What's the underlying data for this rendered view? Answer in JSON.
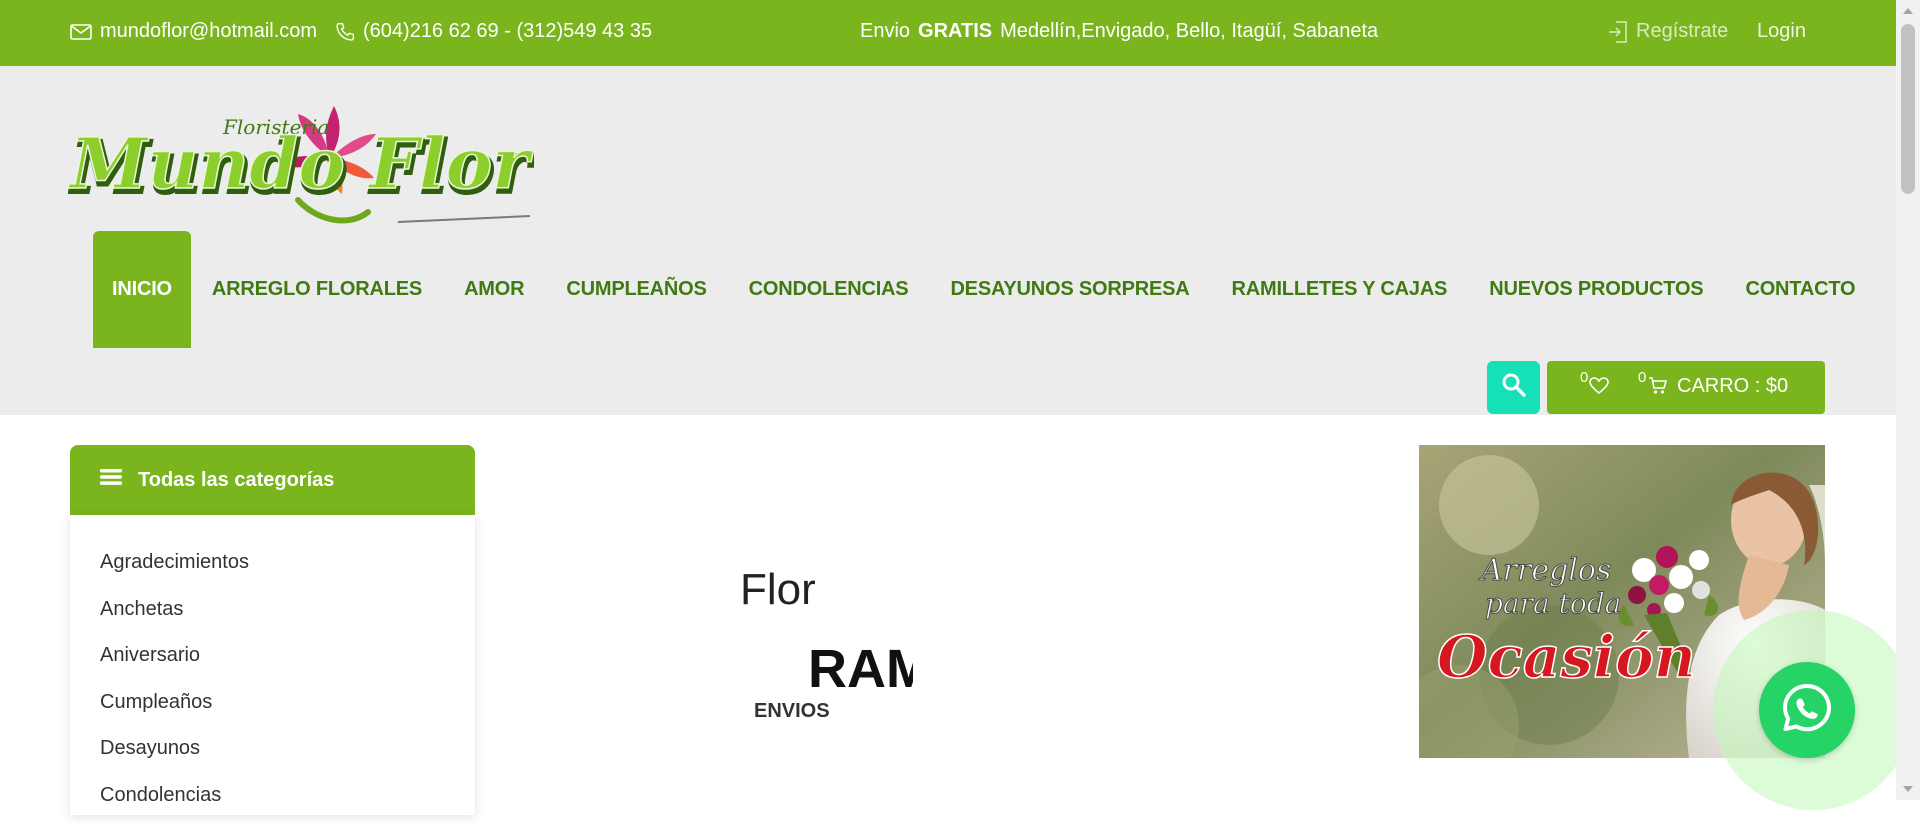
{
  "topbar": {
    "email": "mundoflor@hotmail.com",
    "phone": "(604)216 62 69 - (312)549 43 35",
    "shipping_prefix": "Envio",
    "shipping_bold": "GRATIS",
    "shipping_areas": "Medellín,Envigado, Bello, Itagüí, Sabaneta",
    "register": "Regístrate",
    "login": "Login"
  },
  "logo": {
    "small_text": "Floristeria",
    "main_text": "Mundo Flor"
  },
  "nav": {
    "items": [
      {
        "label": "INICIO"
      },
      {
        "label": "ARREGLO FLORALES"
      },
      {
        "label": "AMOR"
      },
      {
        "label": "CUMPLEAÑOS"
      },
      {
        "label": "CONDOLENCIAS"
      },
      {
        "label": "DESAYUNOS SORPRESA"
      },
      {
        "label": "RAMILLETES Y CAJAS"
      },
      {
        "label": "NUEVOS PRODUCTOS"
      },
      {
        "label": "CONTACTO"
      }
    ]
  },
  "cart": {
    "wishlist_count": "0",
    "cart_count": "0",
    "label": "CARRO : $0"
  },
  "sidebar": {
    "title": "Todas las categorías",
    "items": [
      {
        "label": "Agradecimientos"
      },
      {
        "label": "Anchetas"
      },
      {
        "label": "Aniversario"
      },
      {
        "label": "Cumpleaños"
      },
      {
        "label": "Desayunos"
      },
      {
        "label": "Condolencias"
      }
    ]
  },
  "center": {
    "flor": "Flor",
    "ram": "RAM",
    "envios": "ENVIOS"
  },
  "banner": {
    "line1": "Arreglos",
    "line2": "para toda",
    "line3": "Ocasión"
  },
  "colors": {
    "brand_green": "#7ab51d",
    "nav_text": "#3f7a12",
    "search": "#15e0b7",
    "whatsapp": "#25d366"
  }
}
